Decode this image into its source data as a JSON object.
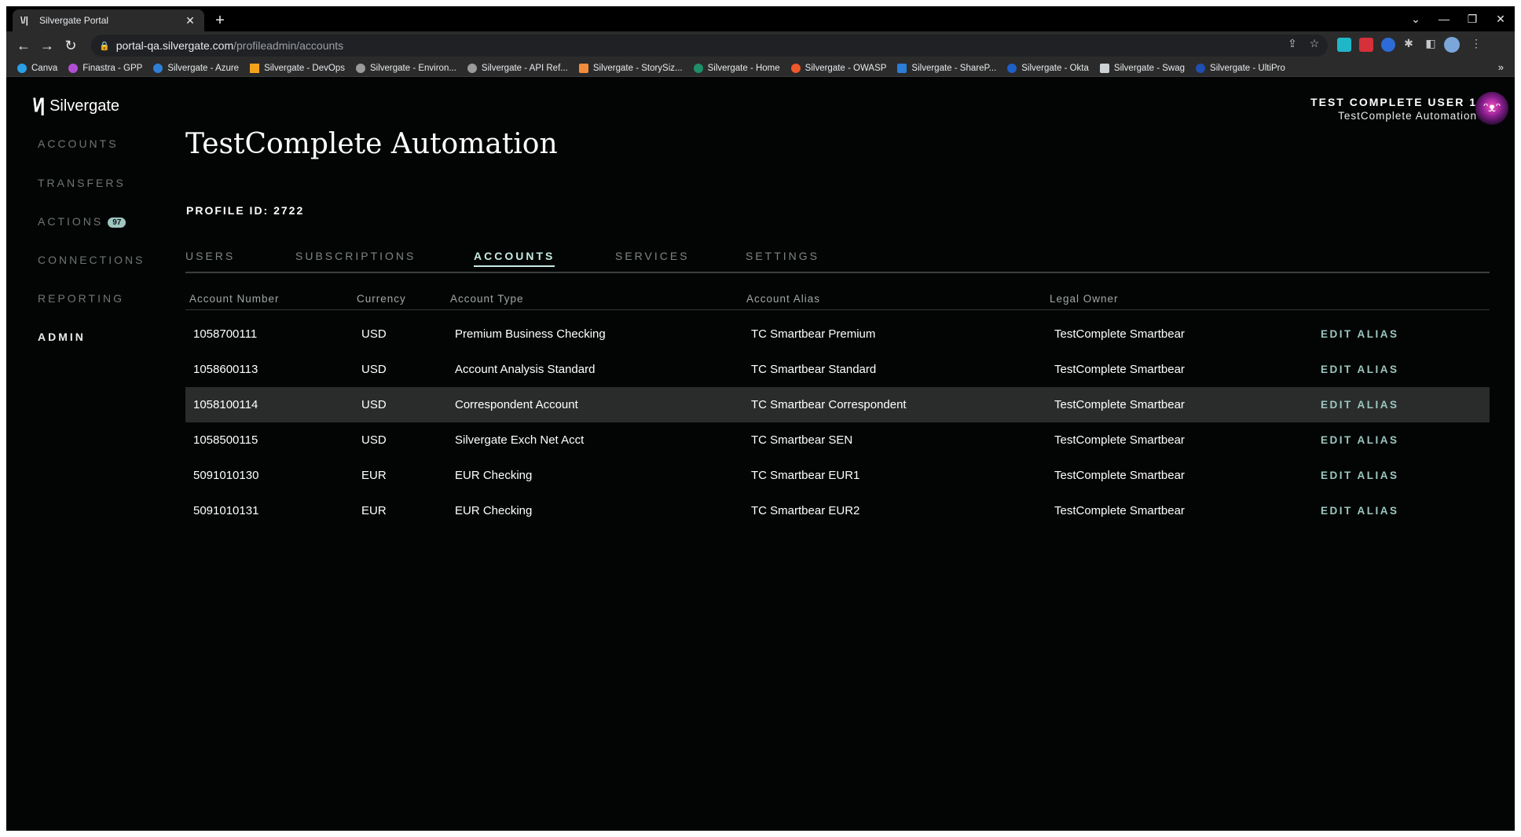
{
  "browser": {
    "tab_title": "Silvergate Portal",
    "tab_close": "✕",
    "new_tab": "+",
    "url_host": "portal-qa.silvergate.com",
    "url_path": "/profileadmin/accounts",
    "bookmarks": [
      {
        "label": "Canva",
        "color": "#2aa0e6"
      },
      {
        "label": "Finastra - GPP",
        "color": "#b04fd6"
      },
      {
        "label": "Silvergate - Azure",
        "color": "#2f7fd6"
      },
      {
        "label": "Silvergate - DevOps",
        "color": "#f2a31b"
      },
      {
        "label": "Silvergate - Environ...",
        "color": "#9a9a9a"
      },
      {
        "label": "Silvergate - API Ref...",
        "color": "#9a9a9a"
      },
      {
        "label": "Silvergate - StorySiz...",
        "color": "#f28c3c"
      },
      {
        "label": "Silvergate - Home",
        "color": "#1e8f68"
      },
      {
        "label": "Silvergate - OWASP",
        "color": "#f0582a"
      },
      {
        "label": "Silvergate - ShareP...",
        "color": "#2b7dd6"
      },
      {
        "label": "Silvergate - Okta",
        "color": "#1f5fc8"
      },
      {
        "label": "Silvergate - Swag",
        "color": "#cfd2d4"
      },
      {
        "label": "Silvergate - UltiPro",
        "color": "#1f4fb0"
      }
    ],
    "bookmarks_more": "»"
  },
  "app": {
    "logo_text": "Silvergate",
    "nav": {
      "accounts": "ACCOUNTS",
      "transfers": "TRANSFERS",
      "actions": "ACTIONS",
      "actions_badge": "97",
      "connections": "CONNECTIONS",
      "reporting": "REPORTING",
      "admin": "ADMIN"
    },
    "user": {
      "name": "TEST COMPLETE USER 1",
      "org": "TestComplete Automation"
    }
  },
  "profile": {
    "title": "TestComplete Automation",
    "profile_id": "PROFILE ID: 2722"
  },
  "tabs": {
    "users": "USERS",
    "subscriptions": "SUBSCRIPTIONS",
    "accounts": "ACCOUNTS",
    "services": "SERVICES",
    "settings": "SETTINGS"
  },
  "table": {
    "headers": {
      "account_number": "Account Number",
      "currency": "Currency",
      "account_type": "Account Type",
      "account_alias": "Account Alias",
      "legal_owner": "Legal Owner"
    },
    "edit_label": "EDIT ALIAS",
    "rows": [
      {
        "number": "1058700111",
        "currency": "USD",
        "type": "Premium Business Checking",
        "alias": "TC Smartbear Premium",
        "owner": "TestComplete Smartbear"
      },
      {
        "number": "1058600113",
        "currency": "USD",
        "type": "Account Analysis Standard",
        "alias": "TC Smartbear Standard",
        "owner": "TestComplete Smartbear"
      },
      {
        "number": "1058100114",
        "currency": "USD",
        "type": "Correspondent Account",
        "alias": "TC Smartbear Correspondent",
        "owner": "TestComplete Smartbear"
      },
      {
        "number": "1058500115",
        "currency": "USD",
        "type": "Silvergate Exch Net Acct",
        "alias": "TC Smartbear SEN",
        "owner": "TestComplete Smartbear"
      },
      {
        "number": "5091010130",
        "currency": "EUR",
        "type": "EUR Checking",
        "alias": "TC Smartbear EUR1",
        "owner": "TestComplete Smartbear"
      },
      {
        "number": "5091010131",
        "currency": "EUR",
        "type": "EUR Checking",
        "alias": "TC Smartbear EUR2",
        "owner": "TestComplete Smartbear"
      }
    ]
  }
}
